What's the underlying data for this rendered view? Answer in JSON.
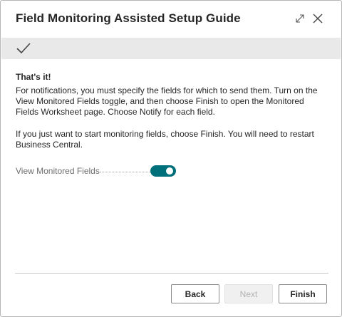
{
  "dialog": {
    "title": "Field Monitoring Assisted Setup Guide",
    "icons": {
      "expand": "expand-icon",
      "close": "close-icon",
      "check": "checkmark-icon"
    }
  },
  "content": {
    "heading": "That's it!",
    "paragraph1": "For notifications, you must specify the fields for which to send them. Turn on the View Monitored Fields toggle, and then choose Finish to open the Monitored Fields Worksheet page. Choose Notify for each field.",
    "paragraph2": "If you just want to start monitoring fields, choose Finish. You will need to restart Business Central."
  },
  "toggle": {
    "label": "View Monitored Fields",
    "on": true,
    "color": "#00707a"
  },
  "footer": {
    "back_label": "Back",
    "next_label": "Next",
    "finish_label": "Finish"
  }
}
